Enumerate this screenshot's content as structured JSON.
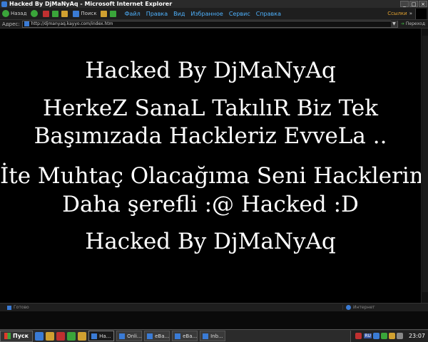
{
  "window": {
    "title": "Hacked By DjMaNyAq - Microsoft Internet Explorer",
    "minimize": "_",
    "maximize": "□",
    "close": "×"
  },
  "toolbar": {
    "back_label": "Назад",
    "search_label": "Поиск",
    "menu": [
      "Файл",
      "Правка",
      "Вид",
      "Избранное",
      "Сервис",
      "Справка"
    ],
    "links_label": "Ссылки"
  },
  "address": {
    "label": "Адрес:",
    "url": "http://djmanyaq.kayyo.com/index.htm",
    "go_label": "Переход"
  },
  "page": {
    "lines": [
      "Hacked By DjMaNyAq",
      "HerkeZ SanaL TakılıR Biz Tek",
      "Başımızada Hackleriz EvveLa ..",
      "İte Muhtaç Olacağıma Seni Hacklerim",
      "Daha şerefli :@ Hacked :D",
      "Hacked By DjMaNyAq"
    ]
  },
  "status": {
    "text": "Готово",
    "zone": "Интернет"
  },
  "taskbar": {
    "start_label": "Пуск",
    "tasks": [
      "Ha...",
      "Onli...",
      "eBa...",
      "eBa...",
      "Inb..."
    ],
    "lang": "RU",
    "clock": "23:07"
  },
  "colors": {
    "menu_text": "#4fb3ff",
    "page_bg": "#000000",
    "page_text": "#ffffff",
    "links": "#e0a030"
  }
}
